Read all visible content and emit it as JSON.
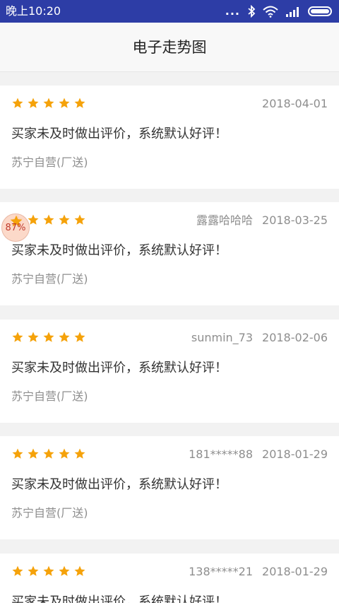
{
  "status_bar": {
    "time": "晚上10:20",
    "icons": [
      "dots-icon",
      "bluetooth-icon",
      "wifi-icon",
      "signal-icon",
      "battery-icon"
    ]
  },
  "header": {
    "title": "电子走势图"
  },
  "colors": {
    "status_bar": "#2d3da6",
    "star": "#f5a20a",
    "meta_text": "#8e8e8e",
    "body_text": "#333333",
    "divider": "#f2f2f2"
  },
  "reviews": [
    {
      "rating": 5,
      "username": "",
      "date": "2018-04-01",
      "text": "买家未及时做出评价，系统默认好评！",
      "shop": "苏宁自营(厂送)"
    },
    {
      "rating": 5,
      "username": "露露哈哈哈",
      "date": "2018-03-25",
      "text": "买家未及时做出评价，系统默认好评！",
      "shop": "苏宁自营(厂送)"
    },
    {
      "rating": 5,
      "username": "sunmin_73",
      "date": "2018-02-06",
      "text": "买家未及时做出评价，系统默认好评！",
      "shop": "苏宁自营(厂送)"
    },
    {
      "rating": 5,
      "username": "181*****88",
      "date": "2018-01-29",
      "text": "买家未及时做出评价，系统默认好评！",
      "shop": "苏宁自营(厂送)"
    },
    {
      "rating": 5,
      "username": "138*****21",
      "date": "2018-01-29",
      "text": "买家未及时做出评价，系统默认好评！",
      "shop": ""
    }
  ],
  "float_badge": {
    "label": "87%"
  }
}
